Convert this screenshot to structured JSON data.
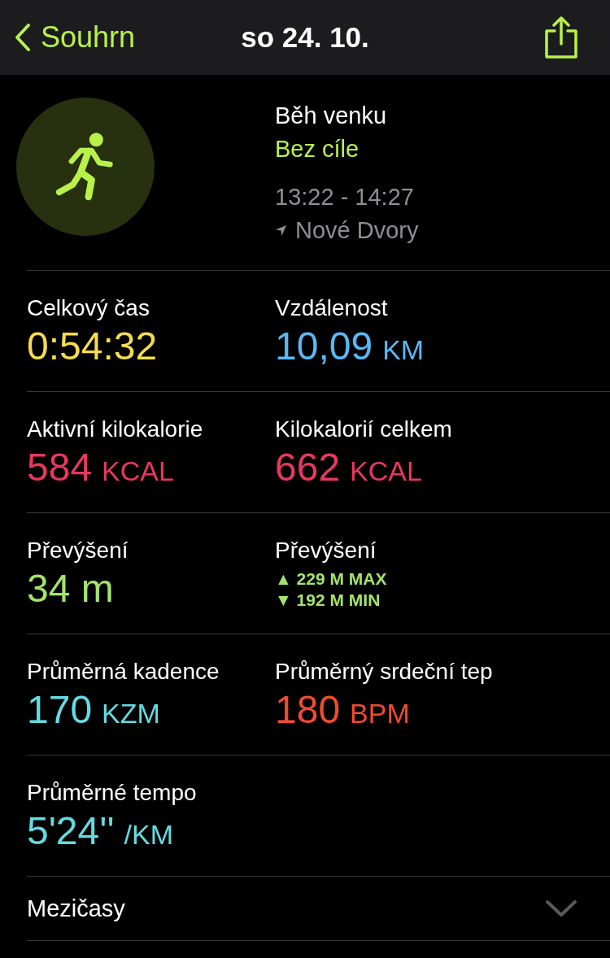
{
  "nav": {
    "back": "Souhrn",
    "title": "so 24. 10."
  },
  "workout": {
    "name": "Běh venku",
    "goal": "Bez cíle",
    "time": "13:22 - 14:27",
    "location": "Nové Dvory"
  },
  "metric_rows": [
    [
      {
        "kind": "value",
        "label": "Celkový čas",
        "value": "0:54:32",
        "color": "#f5dc4e"
      },
      {
        "kind": "value",
        "label": "Vzdálenost",
        "value": "10,09",
        "unit": "KM",
        "color": "#5ab8f6"
      }
    ],
    [
      {
        "kind": "value",
        "label": "Aktivní kilokalorie",
        "value": "584",
        "unit": "KCAL",
        "color": "#e8385c"
      },
      {
        "kind": "value",
        "label": "Kilokalorií celkem",
        "value": "662",
        "unit": "KCAL",
        "color": "#e8385c"
      }
    ],
    [
      {
        "kind": "value",
        "label": "Převýšení",
        "value": "34 m",
        "color": "#a4e36c"
      },
      {
        "kind": "range",
        "label": "Převýšení",
        "lines": [
          "▲ 229 M MAX",
          "▼ 192 M MIN"
        ],
        "color": "#a4e36c"
      }
    ],
    [
      {
        "kind": "value",
        "label": "Průměrná kadence",
        "value": "170",
        "unit": "KZM",
        "color": "#64dbe2"
      },
      {
        "kind": "value",
        "label": "Průměrný srdeční tep",
        "value": "180",
        "unit": "BPM",
        "color": "#f24b2f"
      }
    ],
    [
      {
        "kind": "value",
        "label": "Průměrné tempo",
        "value": "5'24''",
        "unit": "/KM",
        "color": "#64dbe2"
      }
    ]
  ],
  "splits": {
    "label": "Mezičasy",
    "expanded": false
  }
}
